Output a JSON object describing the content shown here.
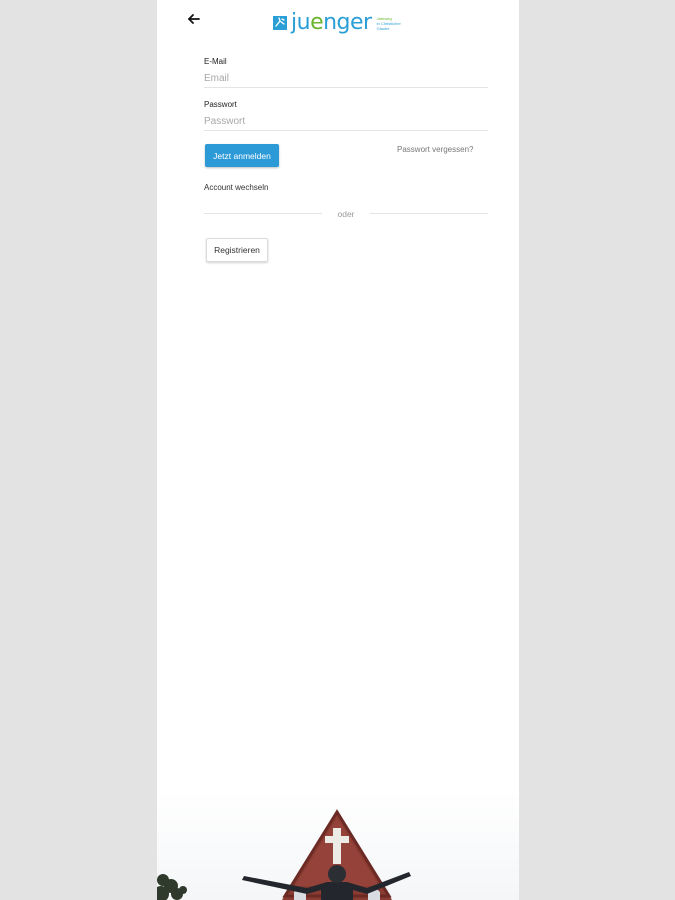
{
  "header": {
    "back_icon": "arrow-left-icon",
    "logo": {
      "text_start": "ju",
      "text_accent": "e",
      "text_end": "nger",
      "tagline_line1": "Jahrweg",
      "tagline_line2": "in Christlicher",
      "tagline_line3": "Glaube",
      "colors": {
        "blue": "#2a9fd6",
        "green": "#6ab42d"
      }
    }
  },
  "form": {
    "email": {
      "label": "E-Mail",
      "placeholder": "Email",
      "value": ""
    },
    "password": {
      "label": "Passwort",
      "placeholder": "Passwort",
      "value": ""
    },
    "login_label": "Jetzt anmelden",
    "forgot_label": "Passwort vergessen?",
    "switch_account_label": "Account wechseln",
    "divider_label": "oder",
    "register_label": "Registrieren"
  },
  "colors": {
    "primary": "#2d9ad8",
    "background": "#e3e3e3",
    "surface": "#ffffff"
  }
}
